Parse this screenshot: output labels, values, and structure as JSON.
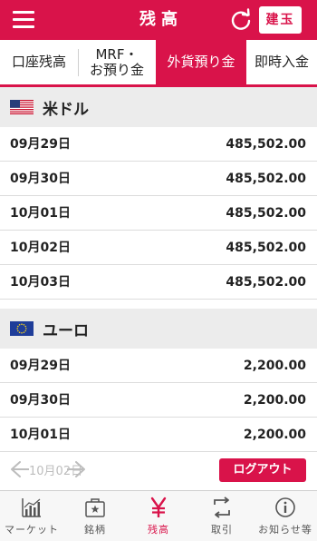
{
  "header": {
    "title": "残高",
    "tategyoku_label": "建玉",
    "menu_icon": "hamburger-menu-icon",
    "refresh_icon": "refresh-icon"
  },
  "tabs": [
    {
      "label": "口座残高",
      "active": false
    },
    {
      "label_line1": "MRF・",
      "label_line2": "お預り金",
      "active": false
    },
    {
      "label": "外貨預り金",
      "active": true
    },
    {
      "label": "即時入金",
      "active": false
    }
  ],
  "sections": [
    {
      "currency": "米ドル",
      "flag_icon": "us-flag-icon",
      "rows": [
        {
          "date": "09月29日",
          "amount": "485,502.00"
        },
        {
          "date": "09月30日",
          "amount": "485,502.00"
        },
        {
          "date": "10月01日",
          "amount": "485,502.00"
        },
        {
          "date": "10月02日",
          "amount": "485,502.00"
        },
        {
          "date": "10月03日",
          "amount": "485,502.00"
        }
      ]
    },
    {
      "currency": "ユーロ",
      "flag_icon": "eu-flag-icon",
      "rows": [
        {
          "date": "09月29日",
          "amount": "2,200.00"
        },
        {
          "date": "09月30日",
          "amount": "2,200.00"
        },
        {
          "date": "10月01日",
          "amount": "2,200.00"
        },
        {
          "date": "10月02日",
          "amount": ""
        }
      ]
    }
  ],
  "overlay": {
    "pager_label": "10月02日",
    "logout_label": "ログアウト"
  },
  "bottom_nav": [
    {
      "label": "マーケット",
      "icon": "chart-icon",
      "active": false
    },
    {
      "label": "銘柄",
      "icon": "briefcase-star-icon",
      "active": false
    },
    {
      "label": "残高",
      "icon": "yen-icon",
      "active": true
    },
    {
      "label": "取引",
      "icon": "trade-arrows-icon",
      "active": false
    },
    {
      "label": "お知らせ等",
      "icon": "info-icon",
      "active": false
    }
  ],
  "colors": {
    "brand": "#d9134a",
    "section_bg": "#ececec",
    "row_border": "#dcdcdc"
  }
}
